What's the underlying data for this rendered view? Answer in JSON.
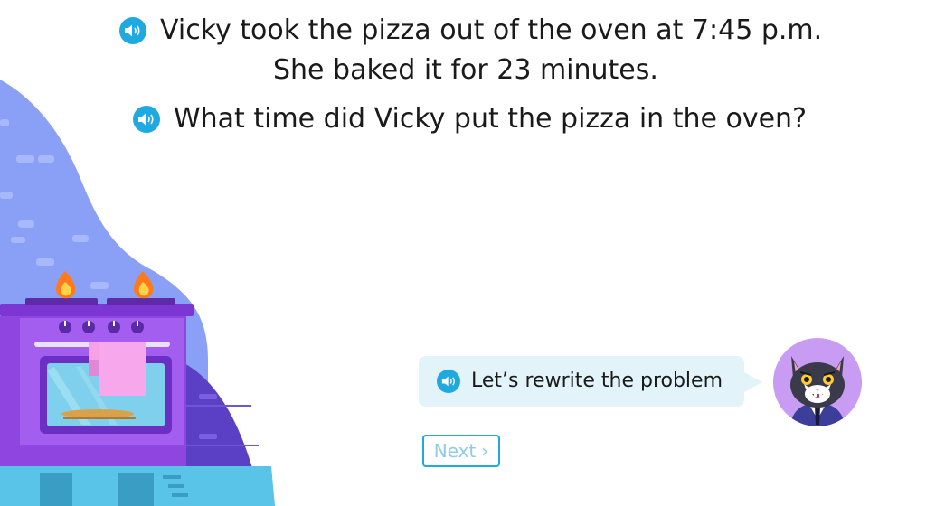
{
  "question": {
    "line1": "Vicky took the pizza out of the oven at 7:45 p.m.",
    "line2": "She baked it for 23 minutes.",
    "line3": "What time did Vicky put the pizza in the oven?"
  },
  "hint": {
    "text": "Let’s rewrite the problem"
  },
  "next_button": {
    "label": "Next",
    "chevron": "›"
  },
  "icons": {
    "audio": "speaker-icon",
    "tutor": "cat-tutor-avatar"
  },
  "colors": {
    "accent": "#1fa9e1",
    "bubble": "#e3f3fa",
    "avatar_bg": "#c79cf2",
    "oven": "#8f46e0",
    "wall": "#8aa0f7"
  }
}
